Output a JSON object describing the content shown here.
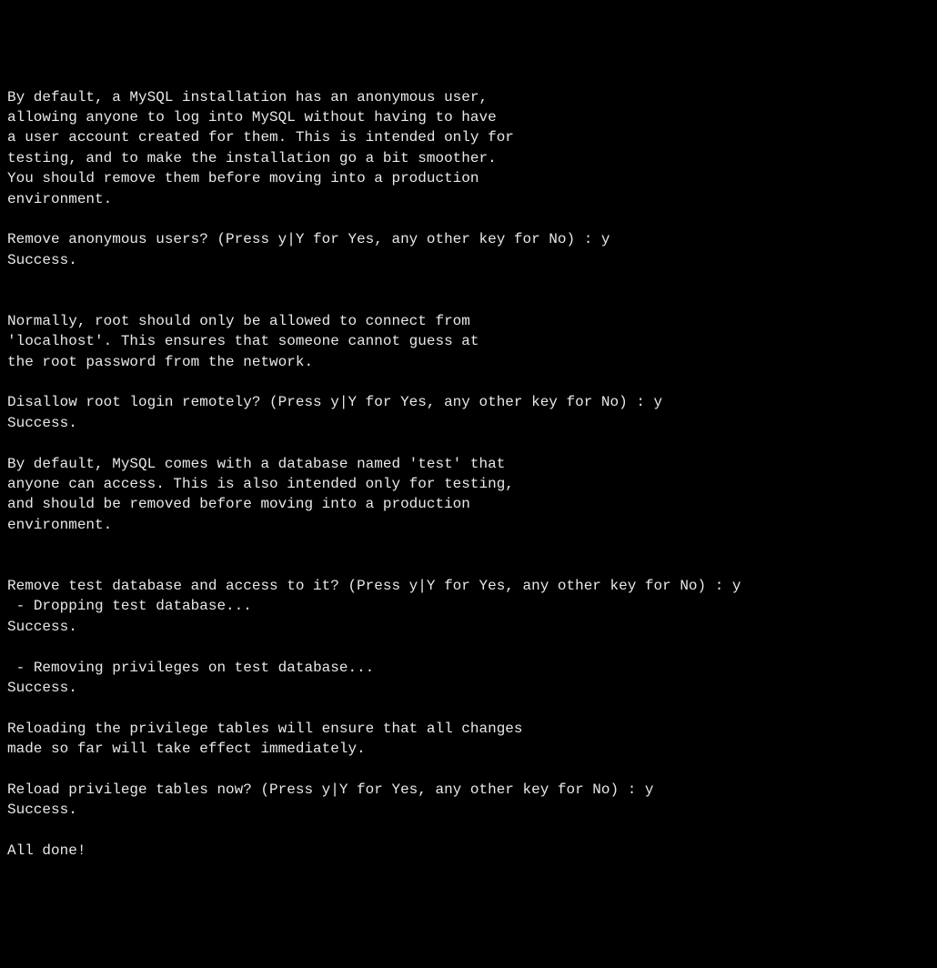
{
  "terminal": {
    "lines": [
      "By default, a MySQL installation has an anonymous user,",
      "allowing anyone to log into MySQL without having to have",
      "a user account created for them. This is intended only for",
      "testing, and to make the installation go a bit smoother.",
      "You should remove them before moving into a production",
      "environment.",
      "",
      "Remove anonymous users? (Press y|Y for Yes, any other key for No) : y",
      "Success.",
      "",
      "",
      "Normally, root should only be allowed to connect from",
      "'localhost'. This ensures that someone cannot guess at",
      "the root password from the network.",
      "",
      "Disallow root login remotely? (Press y|Y for Yes, any other key for No) : y",
      "Success.",
      "",
      "By default, MySQL comes with a database named 'test' that",
      "anyone can access. This is also intended only for testing,",
      "and should be removed before moving into a production",
      "environment.",
      "",
      "",
      "Remove test database and access to it? (Press y|Y for Yes, any other key for No) : y",
      " - Dropping test database...",
      "Success.",
      "",
      " - Removing privileges on test database...",
      "Success.",
      "",
      "Reloading the privilege tables will ensure that all changes",
      "made so far will take effect immediately.",
      "",
      "Reload privilege tables now? (Press y|Y for Yes, any other key for No) : y",
      "Success.",
      "",
      "All done!"
    ]
  }
}
